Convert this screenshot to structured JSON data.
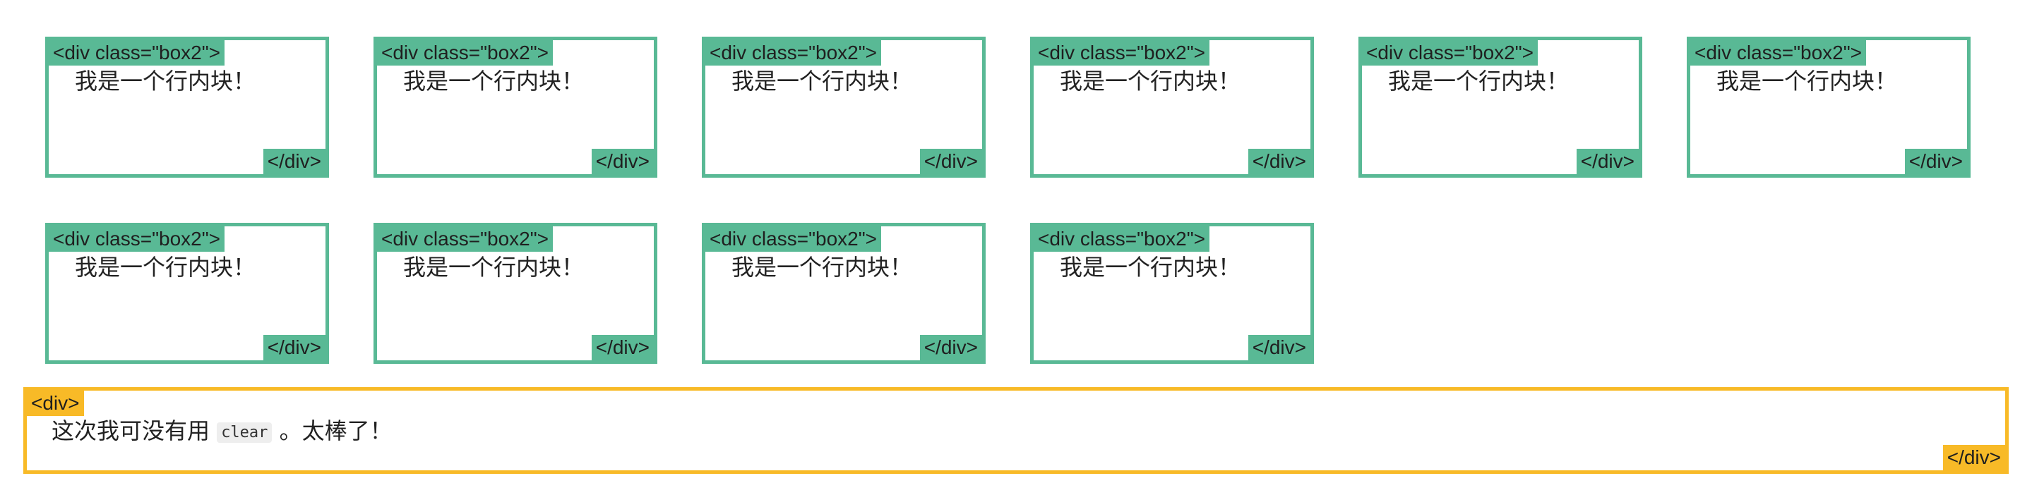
{
  "boxes": [
    {
      "open_tag": "<div class=\"box2\">",
      "text": "我是一个行内块！",
      "close_tag": "</div>"
    },
    {
      "open_tag": "<div class=\"box2\">",
      "text": "我是一个行内块！",
      "close_tag": "</div>"
    },
    {
      "open_tag": "<div class=\"box2\">",
      "text": "我是一个行内块！",
      "close_tag": "</div>"
    },
    {
      "open_tag": "<div class=\"box2\">",
      "text": "我是一个行内块！",
      "close_tag": "</div>"
    },
    {
      "open_tag": "<div class=\"box2\">",
      "text": "我是一个行内块！",
      "close_tag": "</div>"
    },
    {
      "open_tag": "<div class=\"box2\">",
      "text": "我是一个行内块！",
      "close_tag": "</div>"
    },
    {
      "open_tag": "<div class=\"box2\">",
      "text": "我是一个行内块！",
      "close_tag": "</div>"
    },
    {
      "open_tag": "<div class=\"box2\">",
      "text": "我是一个行内块！",
      "close_tag": "</div>"
    },
    {
      "open_tag": "<div class=\"box2\">",
      "text": "我是一个行内块！",
      "close_tag": "</div>"
    },
    {
      "open_tag": "<div class=\"box2\">",
      "text": "我是一个行内块！",
      "close_tag": "</div>"
    }
  ],
  "outer": {
    "open_tag": "<div>",
    "text_before": "这次我可没有用",
    "code": "clear",
    "text_after": "。太棒了！",
    "close_tag": "</div>"
  },
  "colors": {
    "box_accent": "#59b995",
    "outer_accent": "#f8ba27"
  }
}
